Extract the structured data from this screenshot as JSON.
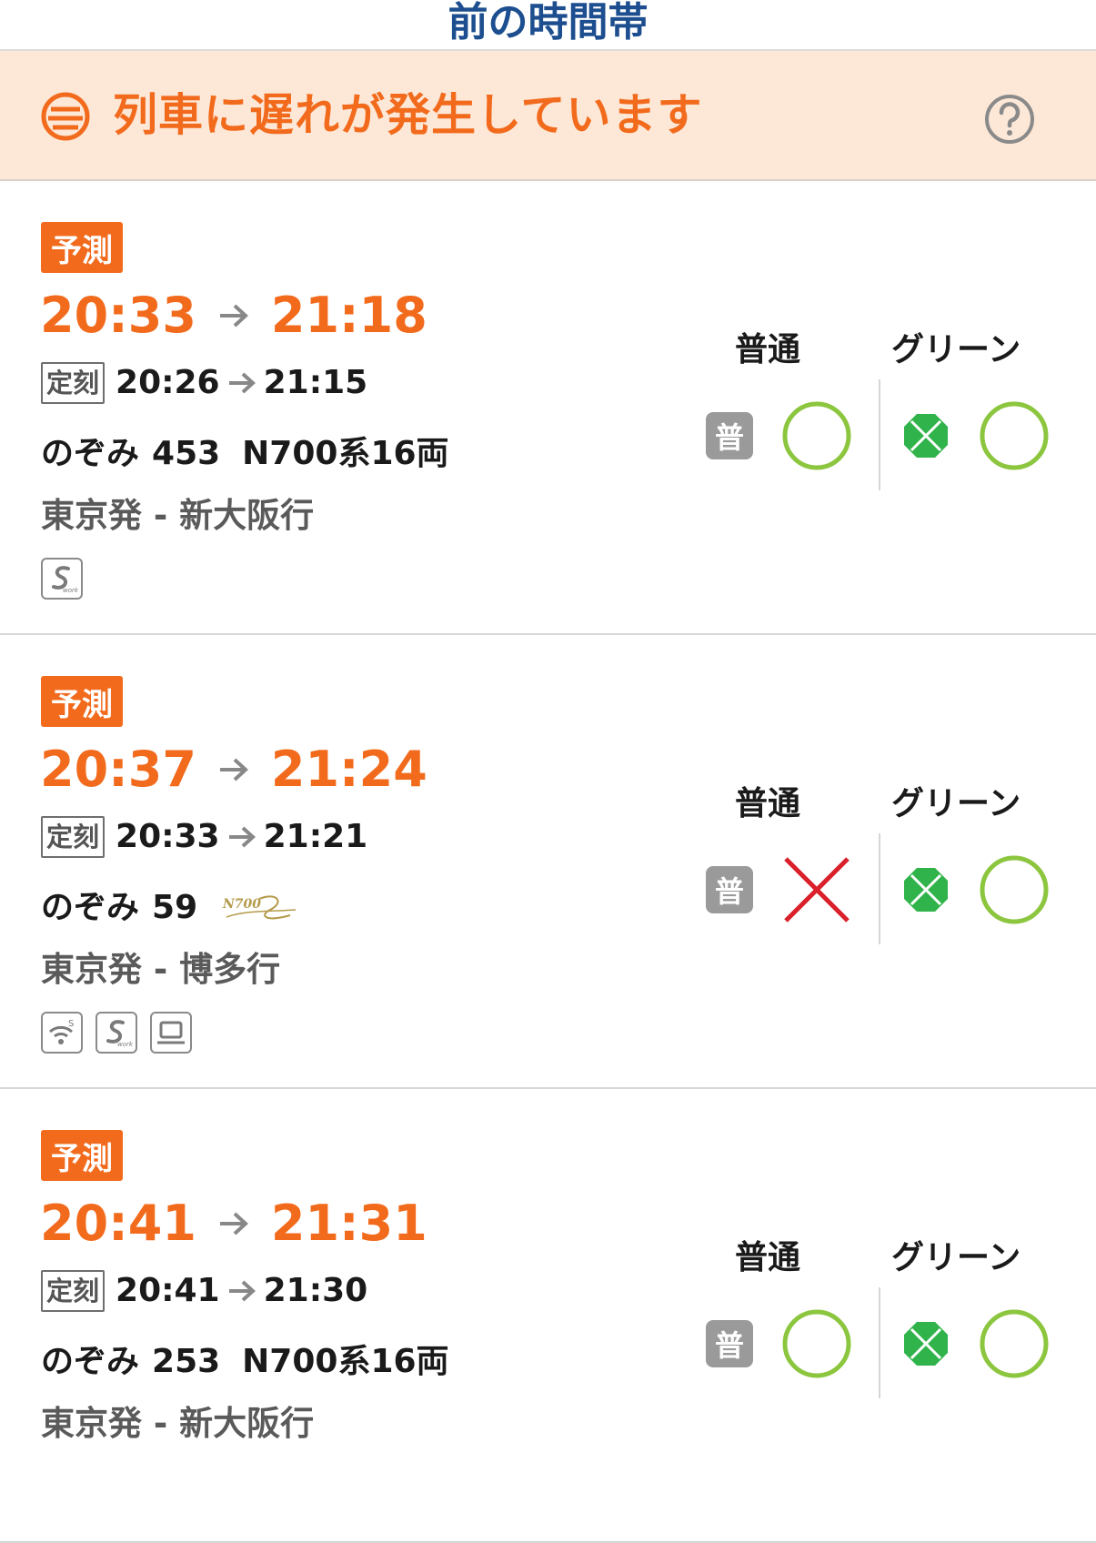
{
  "header": {
    "prev_time_label": "前の時間帯"
  },
  "banner": {
    "delay_message": "列車に遅れが発生しています"
  },
  "labels": {
    "predicted_badge": "予測",
    "scheduled_badge": "定刻",
    "ordinary_seat": "普通",
    "green_seat": "グリーン",
    "ordinary_icon_char": "普"
  },
  "trains": [
    {
      "predicted_departure": "20:33",
      "predicted_arrival": "21:18",
      "scheduled_departure": "20:26",
      "scheduled_arrival": "21:15",
      "name": "のぞみ",
      "number": "453",
      "cars": "N700系16両",
      "route": "東京発 - 新大阪行",
      "amenities": [
        "s-work-icon"
      ],
      "ordinary_status": "available",
      "green_status": "available"
    },
    {
      "predicted_departure": "20:37",
      "predicted_arrival": "21:24",
      "scheduled_departure": "20:33",
      "scheduled_arrival": "21:21",
      "name": "のぞみ",
      "number": "59",
      "cars": "",
      "logo": "N700S",
      "route": "東京発 - 博多行",
      "amenities": [
        "wifi-icon",
        "s-work-icon",
        "laptop-icon"
      ],
      "ordinary_status": "unavailable",
      "green_status": "available"
    },
    {
      "predicted_departure": "20:41",
      "predicted_arrival": "21:31",
      "scheduled_departure": "20:41",
      "scheduled_arrival": "21:30",
      "name": "のぞみ",
      "number": "253",
      "cars": "N700系16両",
      "route": "東京発 - 新大阪行",
      "amenities": [],
      "ordinary_status": "available",
      "green_status": "available"
    }
  ],
  "colors": {
    "accent": "#f26b1d",
    "link": "#1d4e8f",
    "available": "#8cc63f",
    "unavailable": "#d9202b",
    "green_car": "#2fb34a"
  }
}
